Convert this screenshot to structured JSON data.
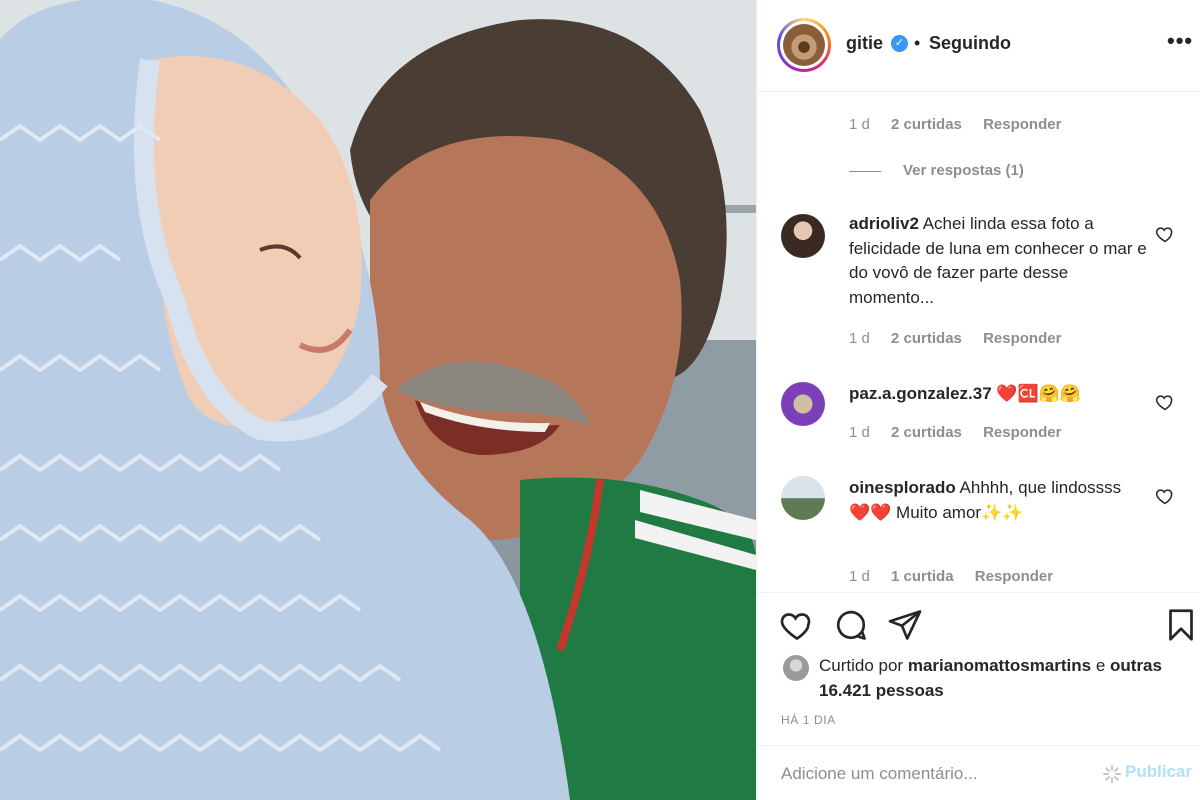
{
  "header": {
    "username": "gitie",
    "separator": "•",
    "follow_status": "Seguindo",
    "more_glyph": "•••",
    "verified_glyph": "✓"
  },
  "comments_top": {
    "meta": {
      "age": "1 d",
      "likes": "2 curtidas",
      "reply": "Responder"
    },
    "view_replies": "Ver respostas (1)"
  },
  "comments": [
    {
      "username": "adrioliv2",
      "text": " Achei linda essa foto a felicidade de luna em conhecer o mar e do vovô de fazer parte desse momento...",
      "age": "1 d",
      "likes": "2 curtidas",
      "reply": "Responder"
    },
    {
      "username": "paz.a.gonzalez.37",
      "text": " ❤️🆑🤗🤗",
      "age": "1 d",
      "likes": "2 curtidas",
      "reply": "Responder"
    },
    {
      "username": "oinesplorado",
      "text": " Ahhhh, que lindossss ❤️❤️ Muito amor✨✨",
      "age": "1 d",
      "likes": "1 curtida",
      "reply": "Responder"
    }
  ],
  "actions": {
    "like_icon": "heart-icon",
    "comment_icon": "comment-bubble-icon",
    "share_icon": "paper-plane-icon",
    "save_icon": "bookmark-icon"
  },
  "likes": {
    "prefix": "Curtido por ",
    "user": "marianomattosmartins",
    "middle": " e ",
    "others": "outras 16.421 pessoas"
  },
  "posted_ago": "HÁ 1 DIA",
  "add_comment": {
    "placeholder": "Adicione um comentário...",
    "publish_label": "Publicar"
  },
  "colors": {
    "verified_blue": "#3897f0",
    "publish_disabled": "#b2dffc",
    "heart_red": "#ed4956",
    "muted_text": "#8e8e8e"
  }
}
